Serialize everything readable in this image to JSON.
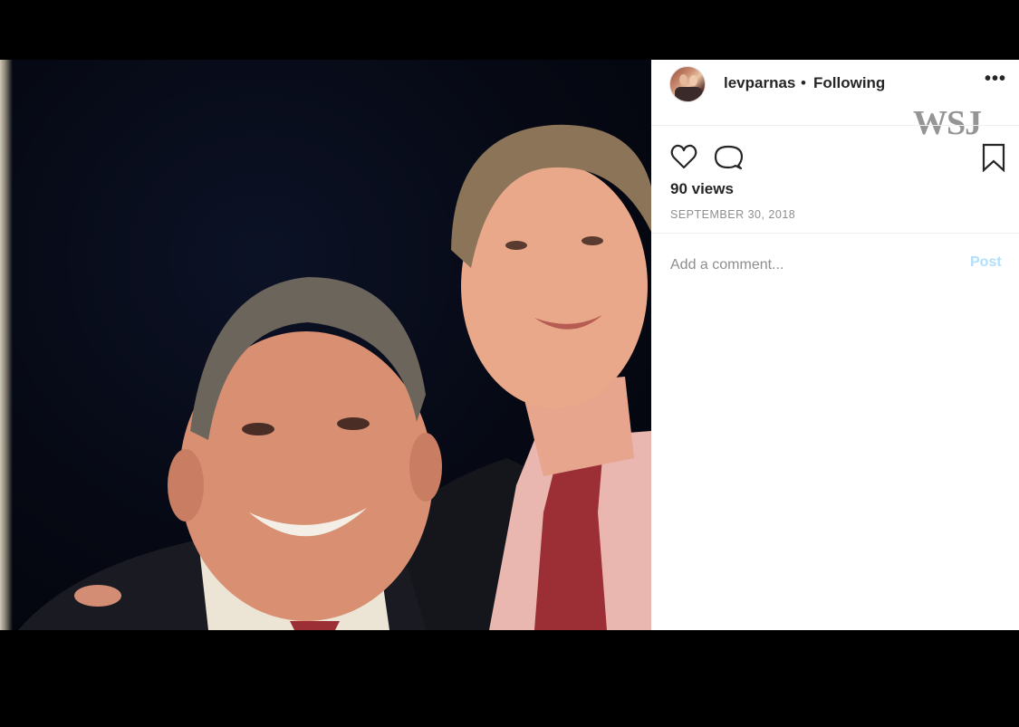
{
  "post": {
    "username": "levparnas",
    "separator": "•",
    "follow_status": "Following",
    "more_icon": "more-horizontal-icon",
    "watermark": "WSJ",
    "views": "90 views",
    "date": "SEPTEMBER 30, 2018",
    "comment_placeholder": "Add a comment...",
    "post_label": "Post",
    "icons": [
      "heart-icon",
      "comment-icon",
      "bookmark-icon"
    ]
  },
  "colors": {
    "text": "#262626",
    "secondary": "#8e8e8e",
    "post_button_disabled": "#b2dffc",
    "letterbox": "#000000"
  }
}
